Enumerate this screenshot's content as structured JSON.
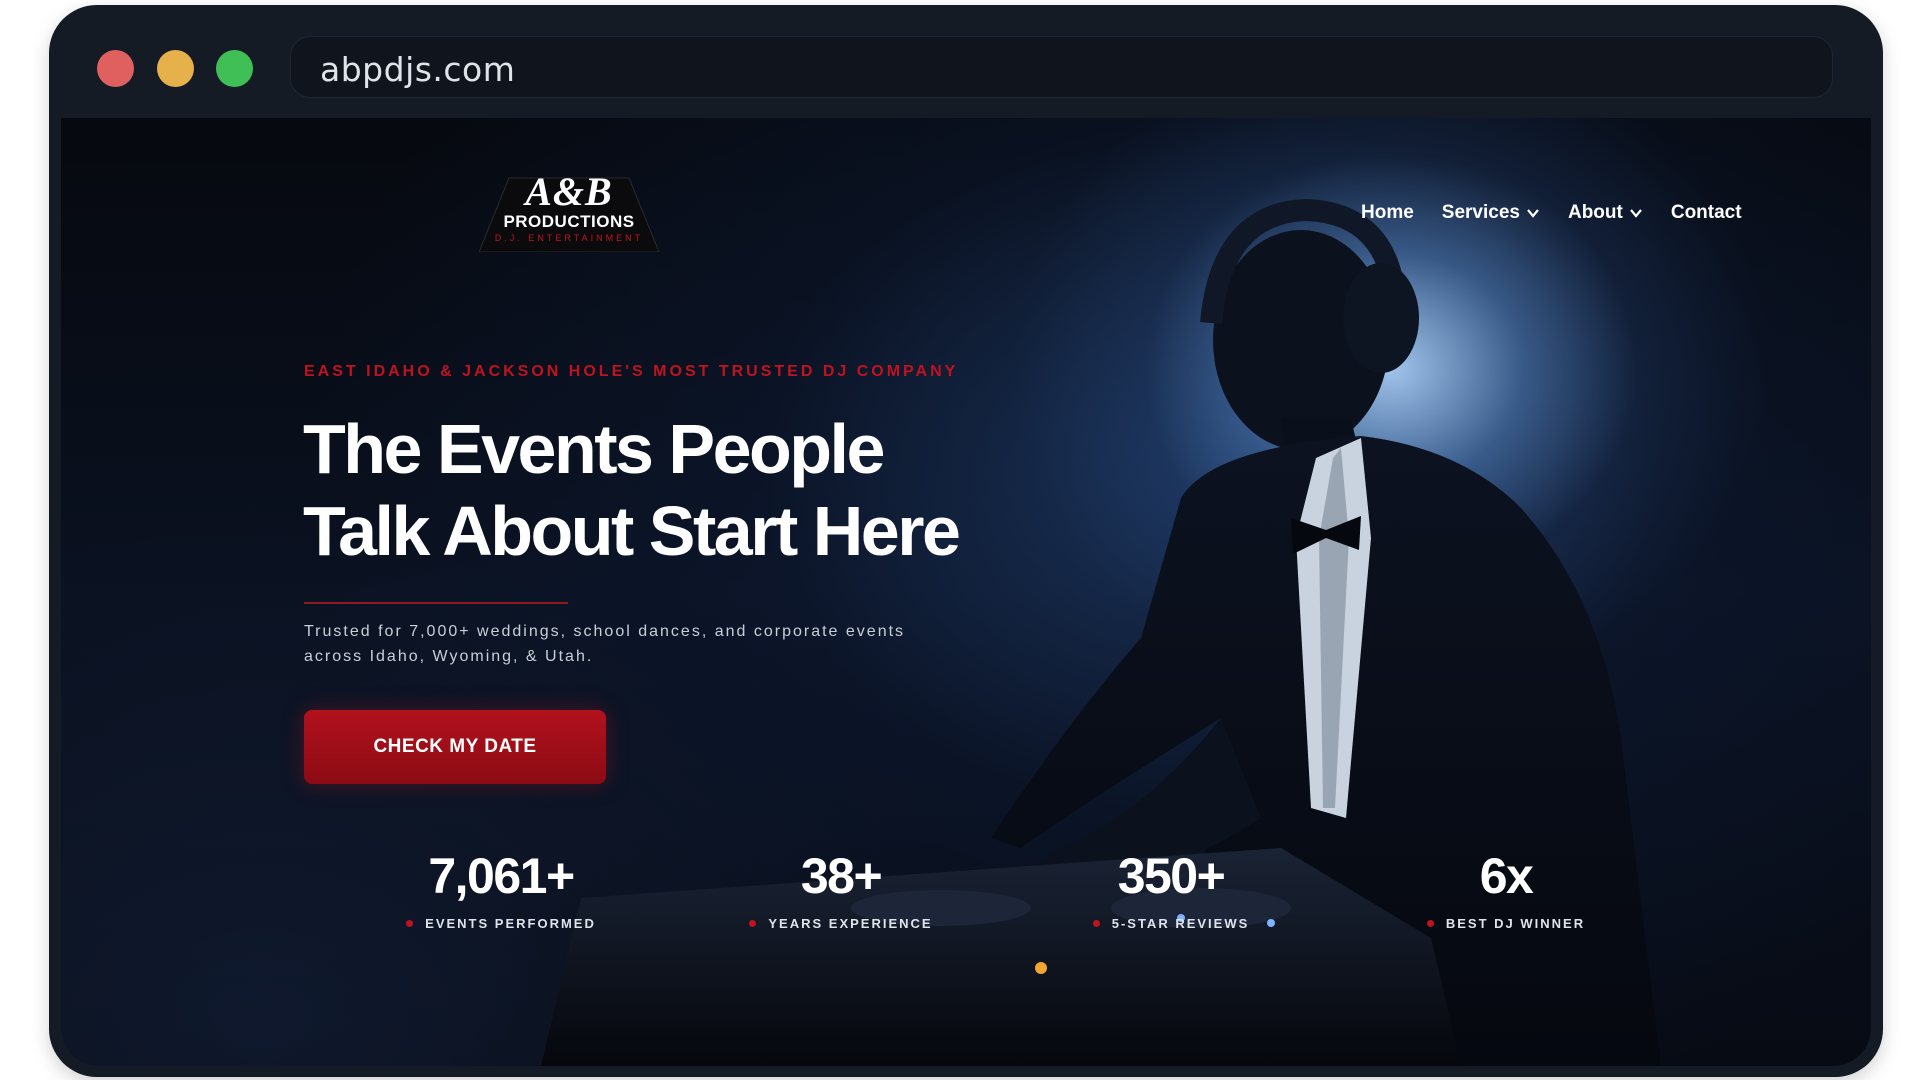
{
  "browser": {
    "url": "abpdjs.com",
    "controls": {
      "close_color": "#e0605f",
      "minimize_color": "#e6b04a",
      "maximize_color": "#3fbf55"
    }
  },
  "logo": {
    "main": "A&B",
    "line2": "PRODUCTIONS",
    "line3": "D.J. ENTERTAINMENT"
  },
  "nav": {
    "items": [
      {
        "label": "Home"
      },
      {
        "label": "Services",
        "icon": "chevron-down-icon"
      },
      {
        "label": "About",
        "icon": "chevron-down-icon"
      },
      {
        "label": "Contact"
      }
    ]
  },
  "hero": {
    "eyebrow": "EAST IDAHO & JACKSON HOLE'S MOST TRUSTED DJ COMPANY",
    "headline_line1": "The Events People",
    "headline_line2": "Talk About Start Here",
    "subtext_line1": "Trusted for 7,000+ weddings, school dances, and corporate events",
    "subtext_line2": "across Idaho, Wyoming, & Utah.",
    "cta_label": "CHECK MY DATE"
  },
  "stats": [
    {
      "value": "7,061+",
      "label": "EVENTS PERFORMED"
    },
    {
      "value": "38+",
      "label": "YEARS EXPERIENCE"
    },
    {
      "value": "350+",
      "label": "5-STAR REVIEWS"
    },
    {
      "value": "6x",
      "label": "BEST DJ WINNER"
    }
  ],
  "colors": {
    "accent": "#c1121f",
    "button": "#a5101a",
    "background": "#070b14",
    "frame": "#151b25"
  }
}
